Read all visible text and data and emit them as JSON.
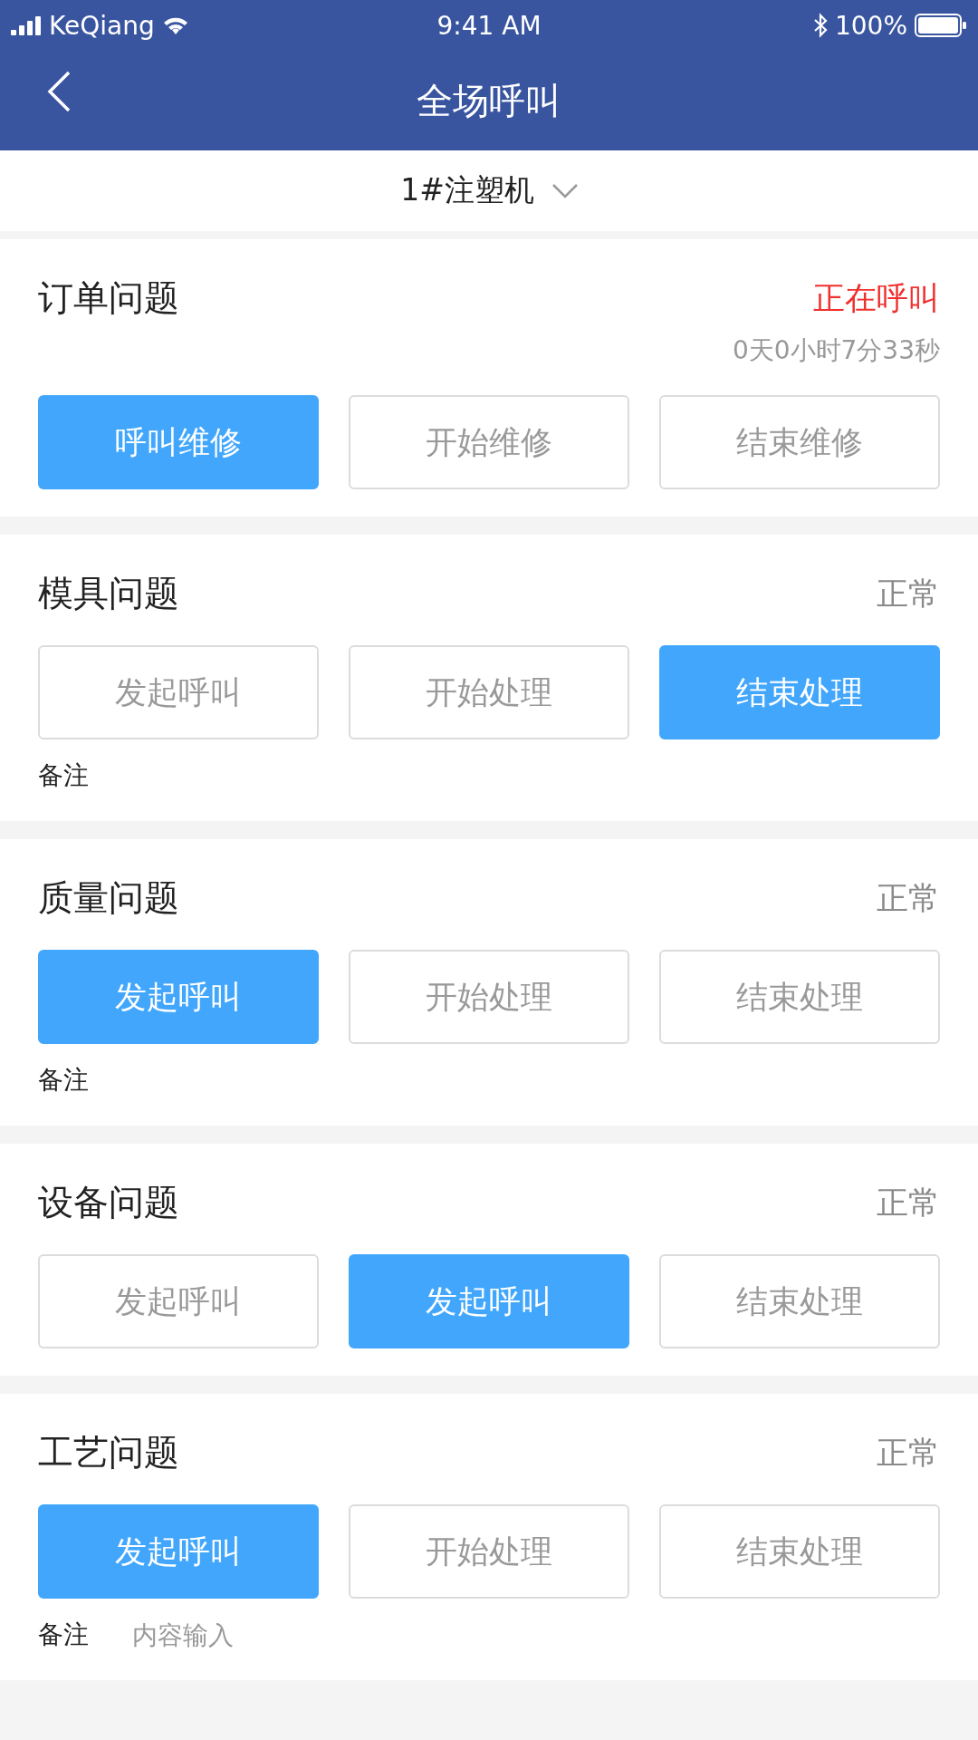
{
  "status_bar": {
    "carrier": "KeQiang",
    "time": "9:41 AM",
    "battery": "100%"
  },
  "nav": {
    "title": "全场呼叫"
  },
  "machine_picker": {
    "value": "1#注塑机"
  },
  "sections": [
    {
      "title": "订单问题",
      "status": "正在呼叫",
      "color": "#f0302e",
      "timer": "0天0小时7分33秒",
      "buttons": [
        {
          "label": "呼叫维修",
          "selected": true
        },
        {
          "label": "开始维修",
          "selected": false
        },
        {
          "label": "结束维修",
          "selected": false
        }
      ]
    },
    {
      "title": "模具问题",
      "status": "正常",
      "color": "#8a8a8a",
      "buttons": [
        {
          "label": "发起呼叫",
          "selected": false
        },
        {
          "label": "开始处理",
          "selected": false
        },
        {
          "label": "结束处理",
          "selected": true
        }
      ],
      "remark": {
        "label": "备注"
      }
    },
    {
      "title": "质量问题",
      "status": "正常",
      "color": "#8a8a8a",
      "buttons": [
        {
          "label": "发起呼叫",
          "selected": true
        },
        {
          "label": "开始处理",
          "selected": false
        },
        {
          "label": "结束处理",
          "selected": false
        }
      ],
      "remark": {
        "label": "备注"
      }
    },
    {
      "title": "设备问题",
      "status": "正常",
      "color": "#8a8a8a",
      "buttons": [
        {
          "label": "发起呼叫",
          "selected": false
        },
        {
          "label": "发起呼叫",
          "selected": true
        },
        {
          "label": "结束处理",
          "selected": false
        }
      ]
    },
    {
      "title": "工艺问题",
      "status": "正常",
      "color": "#8a8a8a",
      "buttons": [
        {
          "label": "发起呼叫",
          "selected": true
        },
        {
          "label": "开始处理",
          "selected": false
        },
        {
          "label": "结束处理",
          "selected": false
        }
      ],
      "remark": {
        "label": "备注",
        "placeholder": "内容输入"
      }
    }
  ]
}
